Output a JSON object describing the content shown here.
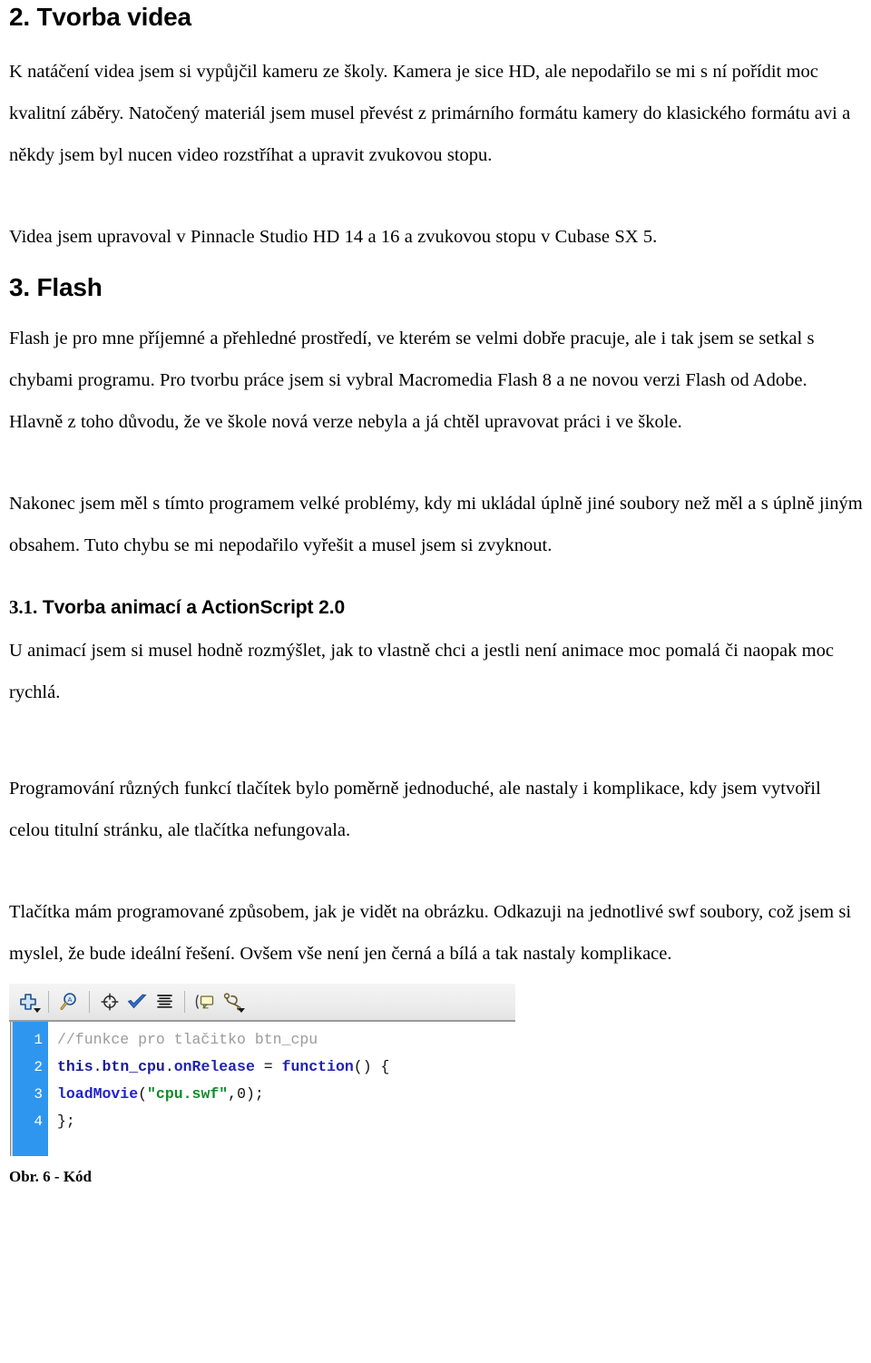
{
  "document": {
    "sections": [
      {
        "id": "sec-2",
        "heading": "2. Tvorba videa",
        "paragraphs": [
          "K natáčení videa jsem si vypůjčil kameru ze školy. Kamera je sice HD, ale nepodařilo se mi s ní pořídit moc kvalitní záběry. Natočený materiál jsem musel převést z primárního formátu kamery do klasického formátu avi a někdy jsem byl nucen video rozstříhat a upravit zvukovou stopu.",
          "Videa jsem upravoval v Pinnacle Studio HD 14 a 16 a zvukovou stopu v Cubase SX 5."
        ]
      },
      {
        "id": "sec-3",
        "heading": "3. Flash",
        "paragraphs": [
          "Flash je pro mne příjemné a přehledné prostředí, ve kterém se velmi dobře pracuje, ale i tak jsem se setkal s chybami programu. Pro tvorbu práce jsem si vybral Macromedia Flash 8 a ne novou verzi Flash od Adobe. Hlavně z toho důvodu, že ve škole nová verze nebyla a já chtěl upravovat práci i ve škole.",
          "Nakonec jsem měl s tímto programem velké problémy, kdy mi ukládal úplně jiné soubory než měl a s úplně jiným obsahem. Tuto chybu se mi nepodařilo vyřešit a musel jsem si zvyknout."
        ]
      },
      {
        "id": "sec-3-1",
        "heading_number": "3.1.",
        "heading_text": "Tvorba animací a ActionScript 2.0",
        "paragraphs": [
          "U animací jsem si musel hodně rozmýšlet, jak to vlastně chci a jestli není animace moc pomalá či naopak moc rychlá.",
          "Programování různých funkcí tlačítek bylo poměrně jednoduché, ale nastaly i komplikace, kdy jsem vytvořil celou titulní stránku, ale tlačítka nefungovala.",
          "Tlačítka mám programované způsobem, jak je vidět na obrázku. Odkazuji na jednotlivé swf soubory, což jsem si myslel, že bude ideální řešení. Ovšem vše není jen černá a bílá a tak nastaly komplikace."
        ]
      }
    ]
  },
  "figure": {
    "caption": "Obr. 6 - Kód",
    "toolbar": {
      "buttons": [
        {
          "name": "add-item-icon",
          "title": "Přidat",
          "has_dropdown": true
        },
        {
          "name": "find-replace-icon",
          "title": "Najít",
          "has_dropdown": false
        },
        {
          "name": "target-insert-icon",
          "title": "Cíl",
          "has_dropdown": false
        },
        {
          "name": "check-syntax-icon",
          "title": "Zkontrolovat syntaxi",
          "has_dropdown": false
        },
        {
          "name": "auto-format-icon",
          "title": "Automatické formátování",
          "has_dropdown": false
        },
        {
          "name": "show-code-hint-icon",
          "title": "Nápověda kódu",
          "has_dropdown": false
        },
        {
          "name": "debug-options-icon",
          "title": "Ladění",
          "has_dropdown": true
        }
      ]
    },
    "editor": {
      "gutter_numbers": [
        "1",
        "2",
        "3",
        "4"
      ],
      "lines": [
        {
          "n": "1",
          "tokens": [
            {
              "t": "comment",
              "v": "//funkce pro tlačitko btn_cpu"
            }
          ]
        },
        {
          "n": "2",
          "tokens": [
            {
              "t": "ident",
              "v": "this"
            },
            {
              "t": "punct",
              "v": "."
            },
            {
              "t": "ident",
              "v": "btn_cpu"
            },
            {
              "t": "punct",
              "v": "."
            },
            {
              "t": "kw",
              "v": "onRelease"
            },
            {
              "t": "punct",
              "v": " = "
            },
            {
              "t": "kw",
              "v": "function"
            },
            {
              "t": "punct",
              "v": "() {"
            }
          ]
        },
        {
          "n": "3",
          "tokens": [
            {
              "t": "fn",
              "v": "loadMovie"
            },
            {
              "t": "punct",
              "v": "("
            },
            {
              "t": "str",
              "v": "\"cpu.swf\""
            },
            {
              "t": "punct",
              "v": ","
            },
            {
              "t": "num",
              "v": "0"
            },
            {
              "t": "punct",
              "v": ");"
            }
          ]
        },
        {
          "n": "4",
          "tokens": [
            {
              "t": "punct",
              "v": "};"
            }
          ]
        }
      ],
      "plain_lines": [
        "//funkce pro tlačitko btn_cpu",
        "this.btn_cpu.onRelease = function() {",
        "loadMovie(\"cpu.swf\",0);",
        "};"
      ]
    }
  },
  "colors": {
    "gutter_blue": "#2f96ef",
    "comment_gray": "#9b9b9b",
    "keyword_blue": "#2222bb",
    "string_green": "#128a2b",
    "toolbar_gray": "#ededed",
    "text_black": "#000000"
  }
}
